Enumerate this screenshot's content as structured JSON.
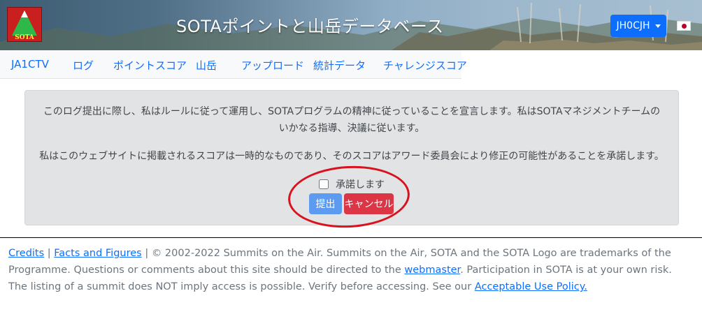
{
  "header": {
    "title": "SOTAポイントと山岳データベース",
    "logo_text": "SOTA",
    "user_button_label": "JH0CJH",
    "language_flag": "japan-flag"
  },
  "nav": {
    "items": [
      {
        "label": "JA1CTV"
      },
      {
        "label": "ログ"
      },
      {
        "label": "ポイントスコア"
      },
      {
        "label": "山岳"
      },
      {
        "label": "アップロード"
      },
      {
        "label": "統計データ"
      },
      {
        "label": "チャレンジスコア"
      }
    ]
  },
  "declaration": {
    "paragraph1": "このログ提出に際し、私はルールに従って運用し、SOTAプログラムの精神に従っていることを宣言します。私はSOTAマネジメントチームのいかなる指導、決議に従います。",
    "paragraph2": "私はこのウェブサイトに掲載されるスコアは一時的なものであり、そのスコアはアワード委員会により修正の可能性があることを承諾します。",
    "checkbox_label": "承諾します",
    "submit_label": "提出",
    "cancel_label": "キャンセル"
  },
  "footer": {
    "credits": "Credits",
    "sep1": " | ",
    "facts": "Facts and Figures",
    "text1": " | © 2002-2022 Summits on the Air. Summits on the Air, SOTA and the SOTA Logo are trademarks of the Programme. Questions or comments about this site should be directed to the ",
    "webmaster": "webmaster",
    "text2": ". Participation in SOTA is at your own risk. The listing of a summit does NOT imply access is possible. Verify before accessing. See our ",
    "policy": "Acceptable Use Policy."
  },
  "colors": {
    "primary": "#0d6efd",
    "danger": "#dc3545",
    "annotation_circle": "#d8121e"
  }
}
